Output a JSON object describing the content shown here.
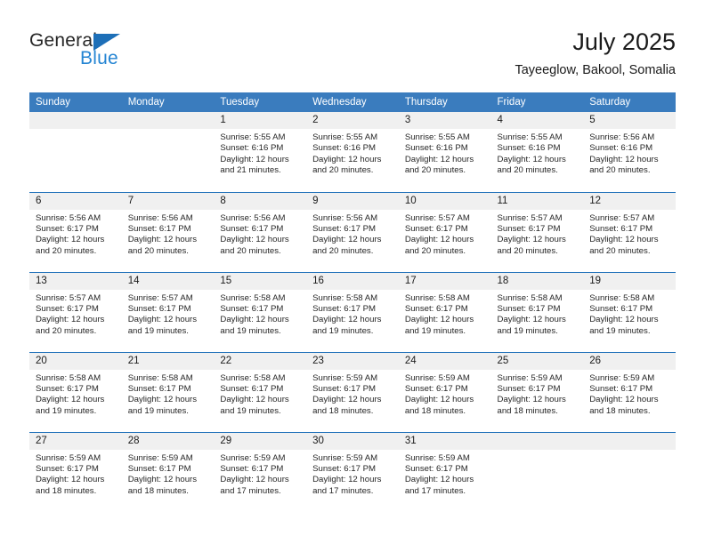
{
  "brand": {
    "name_part1": "General",
    "name_part2": "Blue",
    "triangle_icon": "triangle-icon",
    "accent_color": "#1d6fb8",
    "blue_text_color": "#2585d3"
  },
  "header": {
    "title": "July 2025",
    "subtitle": "Tayeeglow, Bakool, Somalia"
  },
  "calendar": {
    "header_bg": "#3a7cbe",
    "row_divider_color": "#1d6fb8",
    "daynum_bg": "#f0f0f0",
    "weekdays": [
      "Sunday",
      "Monday",
      "Tuesday",
      "Wednesday",
      "Thursday",
      "Friday",
      "Saturday"
    ],
    "weeks": [
      [
        {
          "day": "",
          "sunrise": "",
          "sunset": "",
          "daylight_line1": "",
          "daylight_line2": ""
        },
        {
          "day": "",
          "sunrise": "",
          "sunset": "",
          "daylight_line1": "",
          "daylight_line2": ""
        },
        {
          "day": "1",
          "sunrise": "Sunrise: 5:55 AM",
          "sunset": "Sunset: 6:16 PM",
          "daylight_line1": "Daylight: 12 hours",
          "daylight_line2": "and 21 minutes."
        },
        {
          "day": "2",
          "sunrise": "Sunrise: 5:55 AM",
          "sunset": "Sunset: 6:16 PM",
          "daylight_line1": "Daylight: 12 hours",
          "daylight_line2": "and 20 minutes."
        },
        {
          "day": "3",
          "sunrise": "Sunrise: 5:55 AM",
          "sunset": "Sunset: 6:16 PM",
          "daylight_line1": "Daylight: 12 hours",
          "daylight_line2": "and 20 minutes."
        },
        {
          "day": "4",
          "sunrise": "Sunrise: 5:55 AM",
          "sunset": "Sunset: 6:16 PM",
          "daylight_line1": "Daylight: 12 hours",
          "daylight_line2": "and 20 minutes."
        },
        {
          "day": "5",
          "sunrise": "Sunrise: 5:56 AM",
          "sunset": "Sunset: 6:16 PM",
          "daylight_line1": "Daylight: 12 hours",
          "daylight_line2": "and 20 minutes."
        }
      ],
      [
        {
          "day": "6",
          "sunrise": "Sunrise: 5:56 AM",
          "sunset": "Sunset: 6:17 PM",
          "daylight_line1": "Daylight: 12 hours",
          "daylight_line2": "and 20 minutes."
        },
        {
          "day": "7",
          "sunrise": "Sunrise: 5:56 AM",
          "sunset": "Sunset: 6:17 PM",
          "daylight_line1": "Daylight: 12 hours",
          "daylight_line2": "and 20 minutes."
        },
        {
          "day": "8",
          "sunrise": "Sunrise: 5:56 AM",
          "sunset": "Sunset: 6:17 PM",
          "daylight_line1": "Daylight: 12 hours",
          "daylight_line2": "and 20 minutes."
        },
        {
          "day": "9",
          "sunrise": "Sunrise: 5:56 AM",
          "sunset": "Sunset: 6:17 PM",
          "daylight_line1": "Daylight: 12 hours",
          "daylight_line2": "and 20 minutes."
        },
        {
          "day": "10",
          "sunrise": "Sunrise: 5:57 AM",
          "sunset": "Sunset: 6:17 PM",
          "daylight_line1": "Daylight: 12 hours",
          "daylight_line2": "and 20 minutes."
        },
        {
          "day": "11",
          "sunrise": "Sunrise: 5:57 AM",
          "sunset": "Sunset: 6:17 PM",
          "daylight_line1": "Daylight: 12 hours",
          "daylight_line2": "and 20 minutes."
        },
        {
          "day": "12",
          "sunrise": "Sunrise: 5:57 AM",
          "sunset": "Sunset: 6:17 PM",
          "daylight_line1": "Daylight: 12 hours",
          "daylight_line2": "and 20 minutes."
        }
      ],
      [
        {
          "day": "13",
          "sunrise": "Sunrise: 5:57 AM",
          "sunset": "Sunset: 6:17 PM",
          "daylight_line1": "Daylight: 12 hours",
          "daylight_line2": "and 20 minutes."
        },
        {
          "day": "14",
          "sunrise": "Sunrise: 5:57 AM",
          "sunset": "Sunset: 6:17 PM",
          "daylight_line1": "Daylight: 12 hours",
          "daylight_line2": "and 19 minutes."
        },
        {
          "day": "15",
          "sunrise": "Sunrise: 5:58 AM",
          "sunset": "Sunset: 6:17 PM",
          "daylight_line1": "Daylight: 12 hours",
          "daylight_line2": "and 19 minutes."
        },
        {
          "day": "16",
          "sunrise": "Sunrise: 5:58 AM",
          "sunset": "Sunset: 6:17 PM",
          "daylight_line1": "Daylight: 12 hours",
          "daylight_line2": "and 19 minutes."
        },
        {
          "day": "17",
          "sunrise": "Sunrise: 5:58 AM",
          "sunset": "Sunset: 6:17 PM",
          "daylight_line1": "Daylight: 12 hours",
          "daylight_line2": "and 19 minutes."
        },
        {
          "day": "18",
          "sunrise": "Sunrise: 5:58 AM",
          "sunset": "Sunset: 6:17 PM",
          "daylight_line1": "Daylight: 12 hours",
          "daylight_line2": "and 19 minutes."
        },
        {
          "day": "19",
          "sunrise": "Sunrise: 5:58 AM",
          "sunset": "Sunset: 6:17 PM",
          "daylight_line1": "Daylight: 12 hours",
          "daylight_line2": "and 19 minutes."
        }
      ],
      [
        {
          "day": "20",
          "sunrise": "Sunrise: 5:58 AM",
          "sunset": "Sunset: 6:17 PM",
          "daylight_line1": "Daylight: 12 hours",
          "daylight_line2": "and 19 minutes."
        },
        {
          "day": "21",
          "sunrise": "Sunrise: 5:58 AM",
          "sunset": "Sunset: 6:17 PM",
          "daylight_line1": "Daylight: 12 hours",
          "daylight_line2": "and 19 minutes."
        },
        {
          "day": "22",
          "sunrise": "Sunrise: 5:58 AM",
          "sunset": "Sunset: 6:17 PM",
          "daylight_line1": "Daylight: 12 hours",
          "daylight_line2": "and 19 minutes."
        },
        {
          "day": "23",
          "sunrise": "Sunrise: 5:59 AM",
          "sunset": "Sunset: 6:17 PM",
          "daylight_line1": "Daylight: 12 hours",
          "daylight_line2": "and 18 minutes."
        },
        {
          "day": "24",
          "sunrise": "Sunrise: 5:59 AM",
          "sunset": "Sunset: 6:17 PM",
          "daylight_line1": "Daylight: 12 hours",
          "daylight_line2": "and 18 minutes."
        },
        {
          "day": "25",
          "sunrise": "Sunrise: 5:59 AM",
          "sunset": "Sunset: 6:17 PM",
          "daylight_line1": "Daylight: 12 hours",
          "daylight_line2": "and 18 minutes."
        },
        {
          "day": "26",
          "sunrise": "Sunrise: 5:59 AM",
          "sunset": "Sunset: 6:17 PM",
          "daylight_line1": "Daylight: 12 hours",
          "daylight_line2": "and 18 minutes."
        }
      ],
      [
        {
          "day": "27",
          "sunrise": "Sunrise: 5:59 AM",
          "sunset": "Sunset: 6:17 PM",
          "daylight_line1": "Daylight: 12 hours",
          "daylight_line2": "and 18 minutes."
        },
        {
          "day": "28",
          "sunrise": "Sunrise: 5:59 AM",
          "sunset": "Sunset: 6:17 PM",
          "daylight_line1": "Daylight: 12 hours",
          "daylight_line2": "and 18 minutes."
        },
        {
          "day": "29",
          "sunrise": "Sunrise: 5:59 AM",
          "sunset": "Sunset: 6:17 PM",
          "daylight_line1": "Daylight: 12 hours",
          "daylight_line2": "and 17 minutes."
        },
        {
          "day": "30",
          "sunrise": "Sunrise: 5:59 AM",
          "sunset": "Sunset: 6:17 PM",
          "daylight_line1": "Daylight: 12 hours",
          "daylight_line2": "and 17 minutes."
        },
        {
          "day": "31",
          "sunrise": "Sunrise: 5:59 AM",
          "sunset": "Sunset: 6:17 PM",
          "daylight_line1": "Daylight: 12 hours",
          "daylight_line2": "and 17 minutes."
        },
        {
          "day": "",
          "sunrise": "",
          "sunset": "",
          "daylight_line1": "",
          "daylight_line2": ""
        },
        {
          "day": "",
          "sunrise": "",
          "sunset": "",
          "daylight_line1": "",
          "daylight_line2": ""
        }
      ]
    ]
  }
}
